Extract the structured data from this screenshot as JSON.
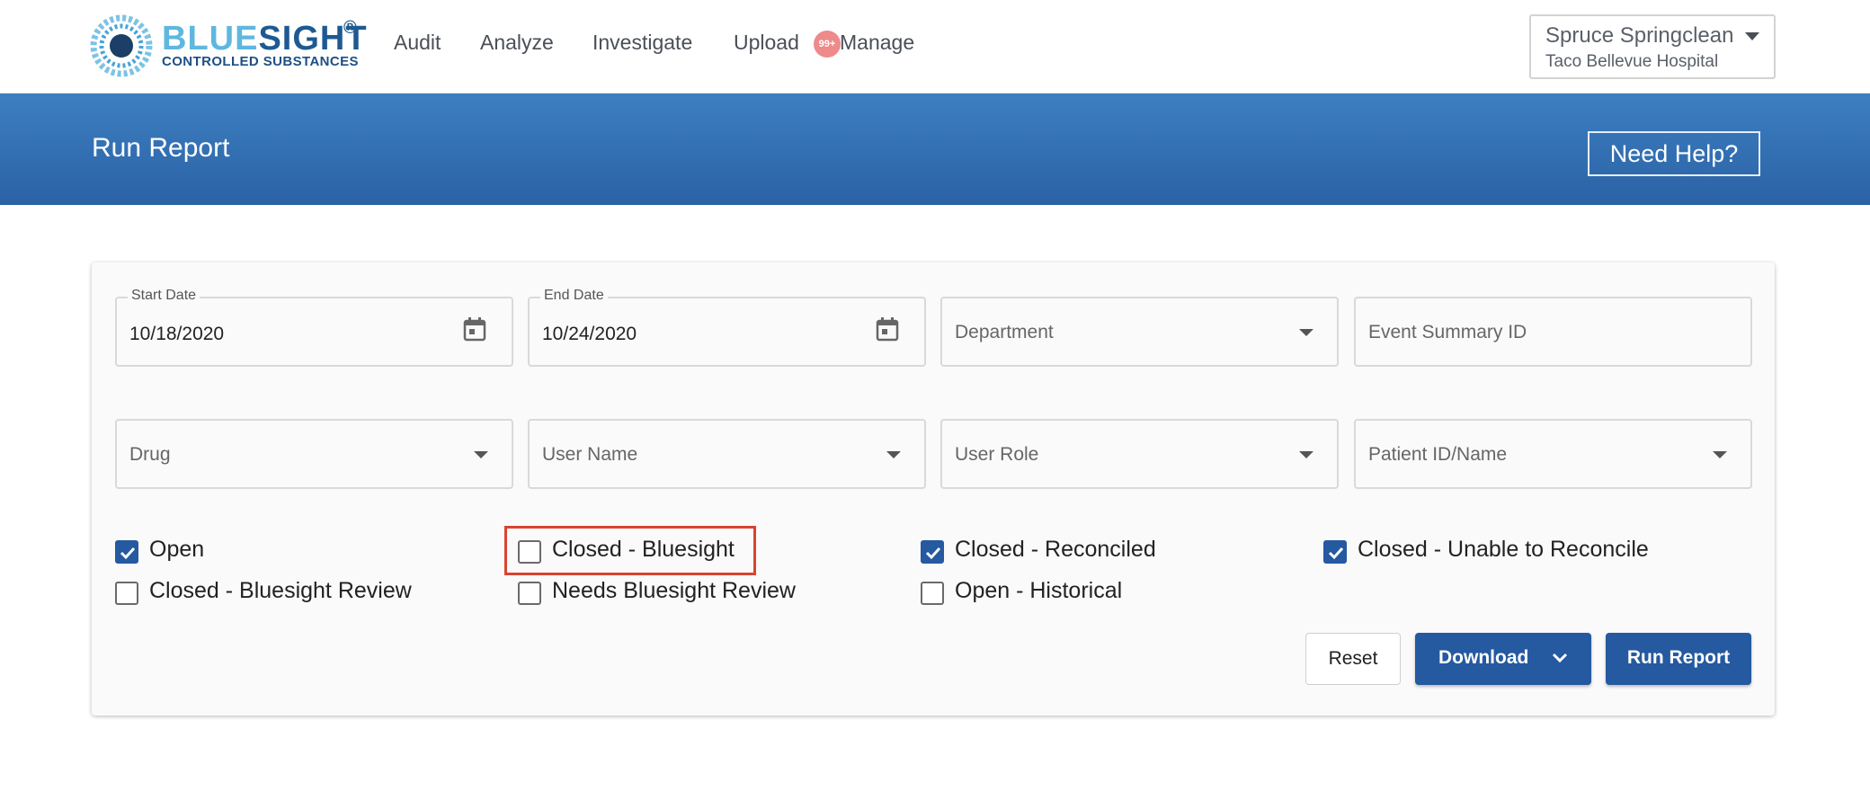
{
  "brand": {
    "name_part1": "BLUE",
    "name_part2": "SIGHT",
    "registered": "®",
    "tagline": "CONTROLLED SUBSTANCES",
    "logo_icon": "bluesight-logo-icon",
    "color_light": "#5fb7e0",
    "color_dark": "#1e5a92"
  },
  "nav": {
    "items": [
      {
        "label": "Audit"
      },
      {
        "label": "Analyze"
      },
      {
        "label": "Investigate"
      },
      {
        "label": "Upload"
      },
      {
        "label": "Manage"
      }
    ],
    "upload_badge": "99+"
  },
  "user": {
    "name": "Spruce Springclean",
    "hospital": "Taco Bellevue Hospital",
    "menu_icon": "caret-down-icon"
  },
  "banner": {
    "title": "Run Report",
    "help_label": "Need Help?",
    "color_top": "#3d7fc1",
    "color_bottom": "#2a62a5"
  },
  "filters": {
    "start_date": {
      "label": "Start Date",
      "value": "10/18/2020",
      "icon": "calendar-icon"
    },
    "end_date": {
      "label": "End Date",
      "value": "10/24/2020",
      "icon": "calendar-icon"
    },
    "department": {
      "placeholder": "Department"
    },
    "event_summary_id": {
      "placeholder": "Event Summary ID"
    },
    "drug": {
      "placeholder": "Drug"
    },
    "user_name": {
      "placeholder": "User Name"
    },
    "user_role": {
      "placeholder": "User Role"
    },
    "patient": {
      "placeholder": "Patient ID/Name"
    }
  },
  "statuses": [
    {
      "label": "Open",
      "checked": true
    },
    {
      "label": "Closed - Bluesight",
      "checked": false,
      "highlighted": true
    },
    {
      "label": "Closed - Reconciled",
      "checked": true
    },
    {
      "label": "Closed - Unable to Reconcile",
      "checked": true
    },
    {
      "label": "Closed - Bluesight Review",
      "checked": false
    },
    {
      "label": "Needs Bluesight Review",
      "checked": false
    },
    {
      "label": "Open - Historical",
      "checked": false
    }
  ],
  "actions": {
    "reset_label": "Reset",
    "download_label": "Download",
    "run_label": "Run Report",
    "primary_color": "#2559a0",
    "highlight_color": "#d9432f"
  }
}
